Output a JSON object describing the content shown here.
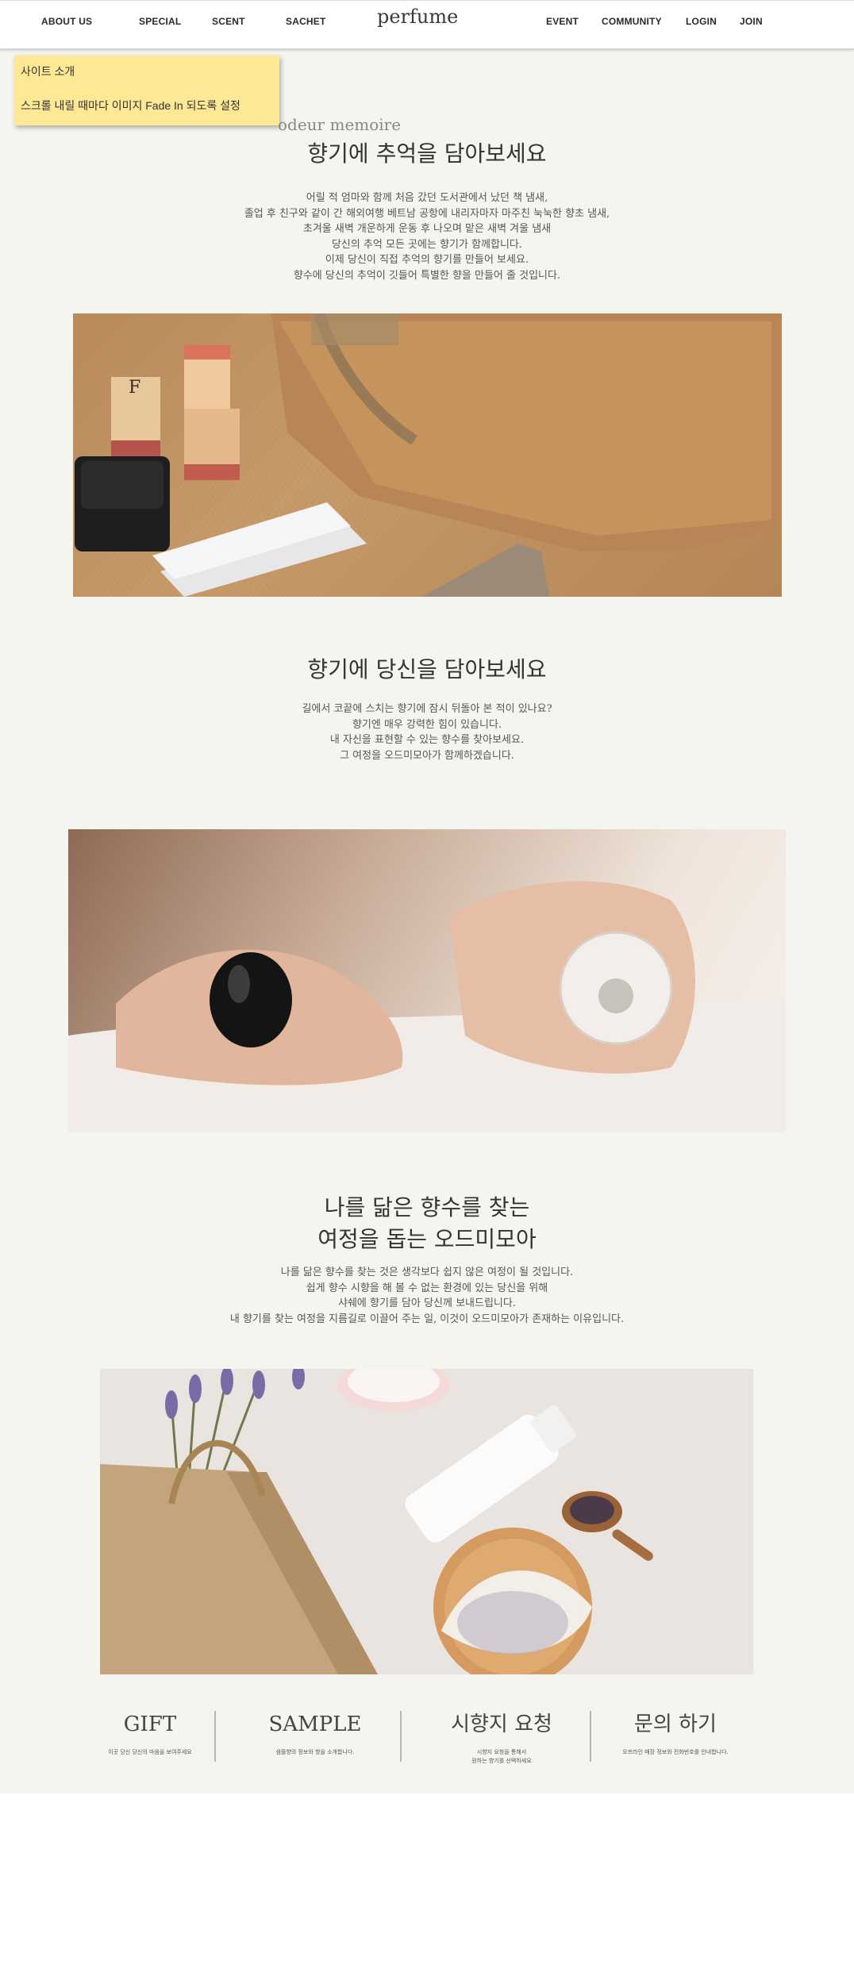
{
  "header": {
    "nav_left": [
      "ABOUT US",
      "SPECIAL",
      "SCENT",
      "SACHET"
    ],
    "logo": "perfume",
    "nav_right": [
      "EVENT",
      "COMMUNITY",
      "LOGIN",
      "JOIN"
    ]
  },
  "note": {
    "line1": "사이트 소개",
    "line2": "스크롤 내릴 때마다 이미지 Fade In 되도록 설정"
  },
  "section1": {
    "subtitle": "odeur memoire",
    "title": "향기에 추억을 담아보세요",
    "lines": [
      "어릴 적 엄마와 함께 처음 갔던 도서관에서 났던 책 냄새,",
      "졸업 후 친구와 같이 간 해외여행 베트남 공항에 내리자마자 마주친 눅눅한 향초 냄새,",
      "초겨울 새벽 개운하게 운동 후 나오며 맡은 새벽 겨울 냄새",
      "당신의 추억 모든 곳에는 향기가 함께합니다.",
      "이제 당신이 직접 추억의 향기를 만들어 보세요.",
      "향수에 당신의 추억이 깃들어 특별한 향을 만들어 줄 것입니다."
    ]
  },
  "section2": {
    "title": "향기에 당신을 담아보세요",
    "lines": [
      "길에서 코끝에 스치는 향기에 잠시 뒤돌아 본 적이 있나요?",
      "향기엔 매우 강력한 힘이 있습니다.",
      "내 자신을 표현할 수 있는 향수를 찾아보세요.",
      "그 여정을 오드미모아가 함께하겠습니다."
    ]
  },
  "section3": {
    "title_line1": "나를 닮은 향수를 찾는",
    "title_line2": "여정을 돕는 오드미모아",
    "lines": [
      "나를 닮은 향수를 찾는 것은 생각보다 쉽지 않은 여정이 될 것입니다.",
      "쉽게 향수 시향을 해 볼 수 없는 환경에 있는 당신을 위해",
      "샤쉐에 향기를 담아 당신께 보내드립니다.",
      "내 향기를 찾는 여정을 지름길로 이끌어 주는 일, 이것이 오드미모아가 존재하는 이유입니다."
    ]
  },
  "bottom_menu": [
    {
      "title": "GIFT",
      "desc": [
        "이곳 당신 당신의 마음을 보여주세요"
      ]
    },
    {
      "title": "SAMPLE",
      "desc": [
        "샘플향의 정보와 향을 소개합니다."
      ]
    },
    {
      "title": "시향지 요청",
      "desc": [
        "시향지 요청을 통해서",
        "원하는 향기를 선택하세요"
      ]
    },
    {
      "title": "문의 하기",
      "desc": [
        "오프라인 매장 정보와 전화번호를 안내합니다."
      ]
    }
  ],
  "images": {
    "img1": "kraft-paper-parcel-with-stamps-and-ink-pad",
    "img2": "hands-holding-perfume-bottle",
    "img3": "paper-bag-lavender-sachet-and-cream-tube"
  }
}
